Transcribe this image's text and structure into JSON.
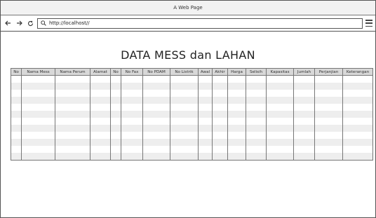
{
  "window": {
    "title": "A Web Page"
  },
  "toolbar": {
    "url": "http://localhost//"
  },
  "page": {
    "title": "DATA MESS dan LAHAN"
  },
  "table": {
    "columns": [
      "No",
      "Nama Mess",
      "Nama Perum",
      "Alamat",
      "No",
      "No Fax",
      "No PDAM",
      "No Listrik",
      "Awal",
      "Akhir",
      "Harga",
      "Selisih",
      "Kapasitas",
      "Jumlah",
      "Perjanjian",
      "Keterangan"
    ],
    "row_count": 12
  }
}
